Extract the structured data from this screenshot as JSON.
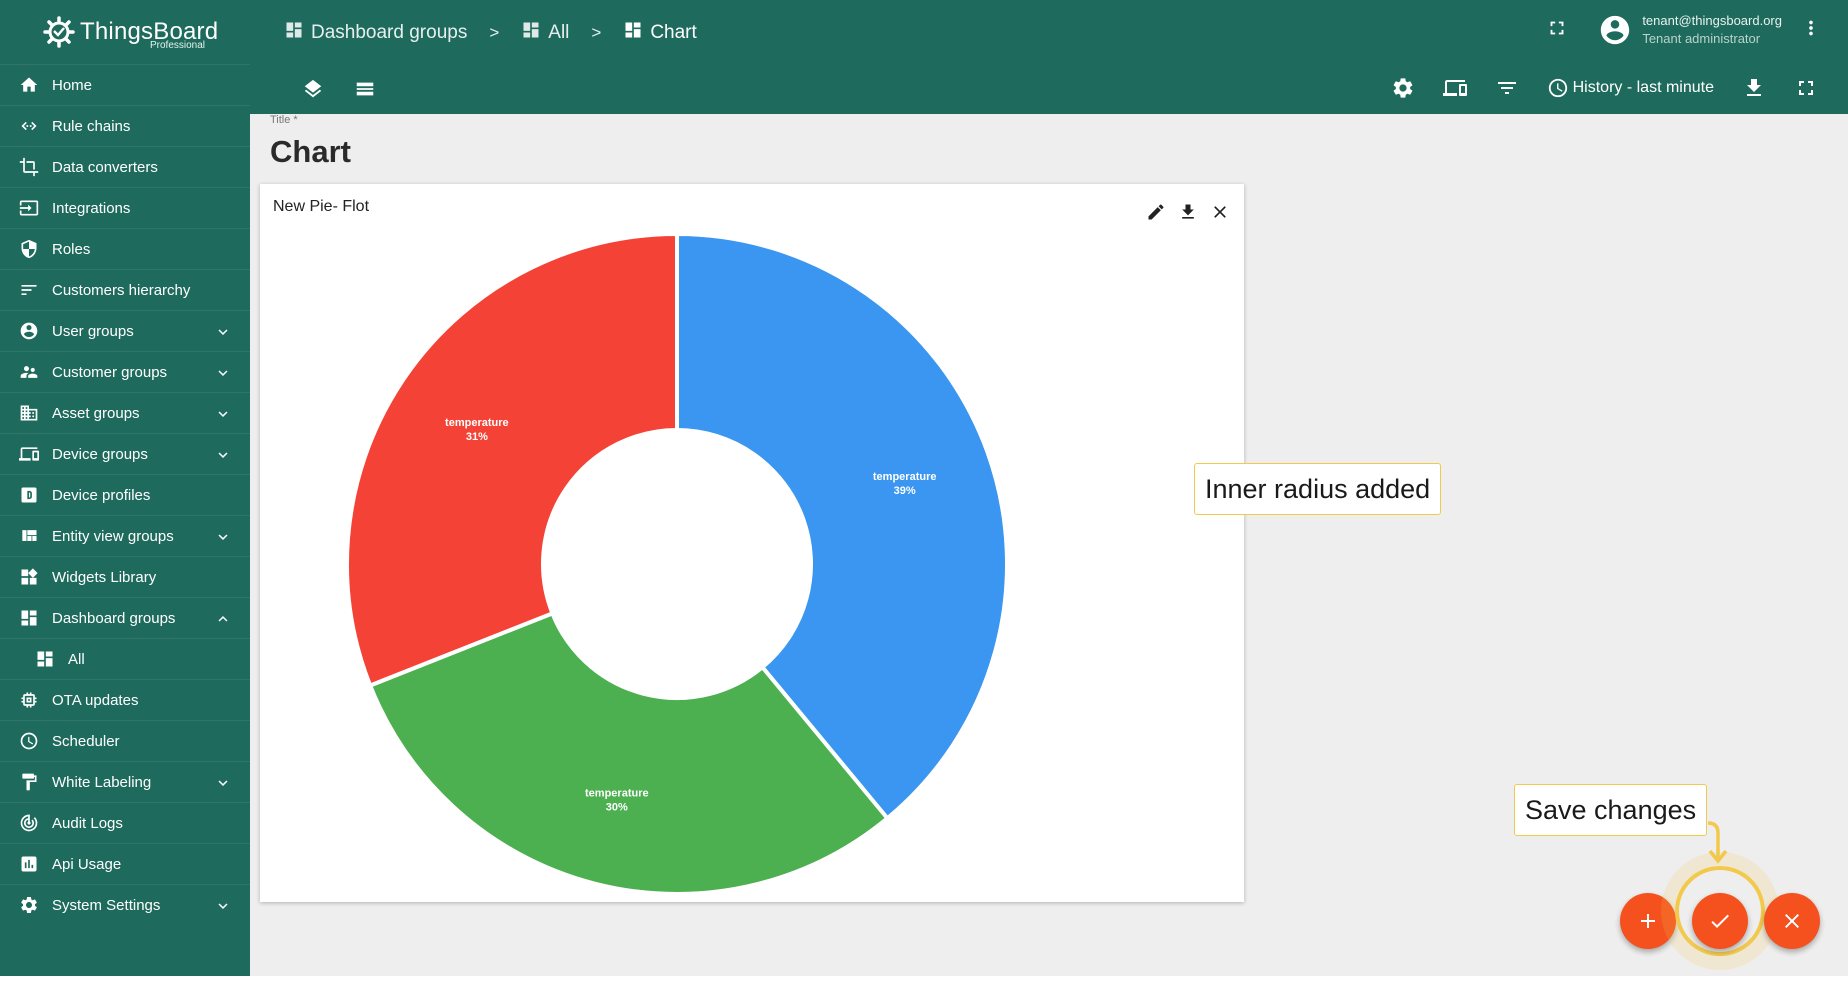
{
  "app": {
    "brand": "ThingsBoard",
    "edition": "Professional"
  },
  "colors": {
    "primary": "#1e6b5d",
    "accent": "#f4511e",
    "highlight": "#f2c94c"
  },
  "sidebar": {
    "items": [
      {
        "label": "Home",
        "icon": "home-icon",
        "expandable": false
      },
      {
        "label": "Rule chains",
        "icon": "rule-chains-icon",
        "expandable": false
      },
      {
        "label": "Data converters",
        "icon": "crop-icon",
        "expandable": false
      },
      {
        "label": "Integrations",
        "icon": "input-icon",
        "expandable": false
      },
      {
        "label": "Roles",
        "icon": "shield-icon",
        "expandable": false
      },
      {
        "label": "Customers hierarchy",
        "icon": "sort-icon",
        "expandable": false
      },
      {
        "label": "User groups",
        "icon": "account-circle-icon",
        "expandable": true
      },
      {
        "label": "Customer groups",
        "icon": "supervisor-icon",
        "expandable": true
      },
      {
        "label": "Asset groups",
        "icon": "domain-icon",
        "expandable": true
      },
      {
        "label": "Device groups",
        "icon": "devices-icon",
        "expandable": true
      },
      {
        "label": "Device profiles",
        "icon": "device-profile-icon",
        "expandable": false
      },
      {
        "label": "Entity view groups",
        "icon": "view-quilt-icon",
        "expandable": true
      },
      {
        "label": "Widgets Library",
        "icon": "widgets-icon",
        "expandable": false
      },
      {
        "label": "Dashboard groups",
        "icon": "dashboard-icon",
        "expandable": true,
        "expanded": true
      },
      {
        "label": "All",
        "icon": "dashboard-icon",
        "sub": true
      },
      {
        "label": "OTA updates",
        "icon": "memory-icon",
        "expandable": false
      },
      {
        "label": "Scheduler",
        "icon": "clock-icon",
        "expandable": false
      },
      {
        "label": "White Labeling",
        "icon": "format-paint-icon",
        "expandable": true
      },
      {
        "label": "Audit Logs",
        "icon": "track-changes-icon",
        "expandable": false
      },
      {
        "label": "Api Usage",
        "icon": "insert-chart-icon",
        "expandable": false
      },
      {
        "label": "System Settings",
        "icon": "settings-icon",
        "expandable": true
      }
    ]
  },
  "header": {
    "breadcrumb": [
      "Dashboard groups",
      "All",
      "Chart"
    ],
    "separator": ">",
    "user_email": "tenant@thingsboard.org",
    "user_role": "Tenant administrator",
    "history_label": "History - last minute"
  },
  "main": {
    "title_label": "Title *",
    "title": "Chart",
    "widget_title": "New Pie- Flot"
  },
  "chart_data": {
    "type": "pie",
    "donut": true,
    "series": [
      {
        "name": "temperature",
        "value": 39,
        "color": "#3a96f0"
      },
      {
        "name": "temperature",
        "value": 30,
        "color": "#4caf50"
      },
      {
        "name": "temperature",
        "value": 31,
        "color": "#f44336"
      }
    ]
  },
  "callouts": {
    "inner_radius": "Inner radius added",
    "save_changes": "Save changes"
  }
}
